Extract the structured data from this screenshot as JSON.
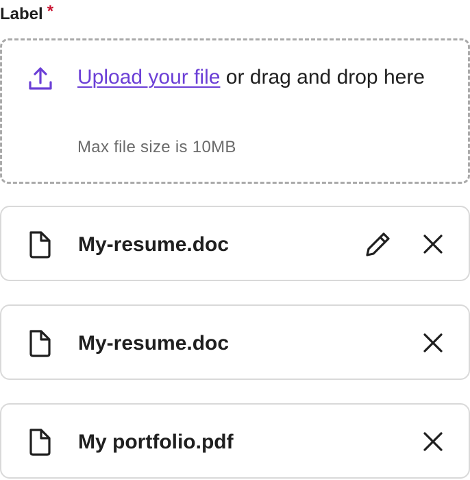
{
  "field": {
    "label": "Label",
    "required_mark": "*"
  },
  "dropzone": {
    "link_text": "Upload your file",
    "text": " or drag and drop here",
    "helper": "Max file size is 10MB",
    "icon": "upload-icon"
  },
  "files": [
    {
      "name": "My-resume.doc",
      "icon": "file-icon",
      "actions": [
        "edit",
        "remove"
      ]
    },
    {
      "name": "My-resume.doc",
      "icon": "file-icon",
      "actions": [
        "remove"
      ]
    },
    {
      "name": "My portfolio.pdf",
      "icon": "file-icon",
      "actions": [
        "remove"
      ]
    }
  ],
  "colors": {
    "accent": "#6b3fd6",
    "required": "#c8102e",
    "border_dashed": "#a9a9a9",
    "border_row": "#d9d9d9",
    "text": "#1f1f1f",
    "helper_text": "#6b6b6b"
  }
}
